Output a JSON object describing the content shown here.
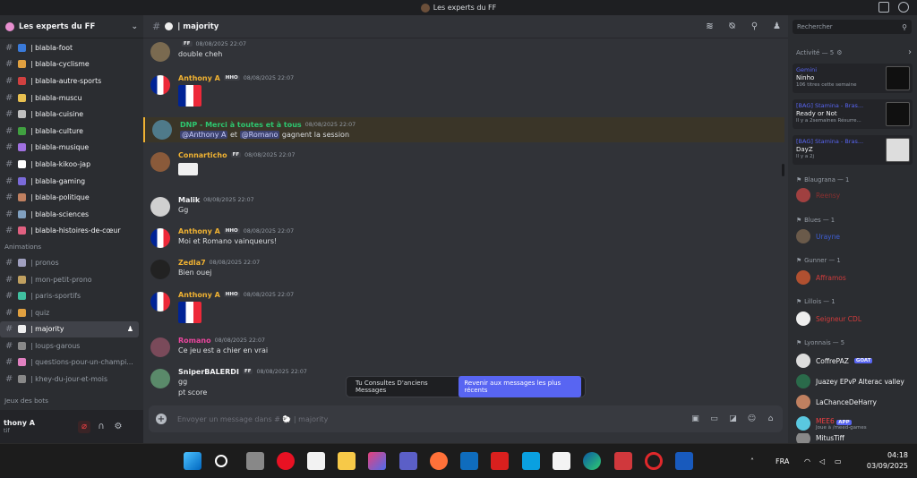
{
  "window": {
    "title": "Les experts du FF"
  },
  "server": {
    "name": "Les experts du FF"
  },
  "channels": [
    {
      "icon": "globe",
      "name": "| blabla-foot"
    },
    {
      "icon": "cyclist",
      "name": "| blabla-cyclisme"
    },
    {
      "icon": "hockey",
      "name": "| blabla-autre-sports"
    },
    {
      "icon": "muscle",
      "name": "| blabla-muscu"
    },
    {
      "icon": "cooking",
      "name": "| blabla-cuisine"
    },
    {
      "icon": "books",
      "name": "| blabla-culture"
    },
    {
      "icon": "music",
      "name": "| blabla-musique"
    },
    {
      "icon": "japan-flag",
      "name": "| blabla-kikoo-jap"
    },
    {
      "icon": "gamepad",
      "name": "| blabla-gaming"
    },
    {
      "icon": "politics",
      "name": "| blabla-politique"
    },
    {
      "icon": "microscope",
      "name": "| blabla-sciences"
    },
    {
      "icon": "hearts",
      "name": "| blabla-histoires-de-cœur"
    }
  ],
  "category_animations": "Animations",
  "anim_channels": [
    {
      "icon": "dice",
      "name": "| pronos"
    },
    {
      "icon": "horse",
      "name": "| mon-petit-prono"
    },
    {
      "icon": "bills",
      "name": "| paris-sportifs"
    },
    {
      "icon": "cookie",
      "name": "| quiz"
    },
    {
      "icon": "sheep",
      "name": "| majority"
    },
    {
      "icon": "wolf",
      "name": "| loups-garous"
    },
    {
      "icon": "brain",
      "name": "| questions-pour-un-champi..."
    },
    {
      "icon": "chains",
      "name": "| khey-du-jour-et-mois"
    }
  ],
  "category_bots": "Jeux des bots",
  "user": {
    "name": "thony A",
    "status": "tif"
  },
  "header": {
    "channel": "| majority"
  },
  "messages": [
    {
      "name": "",
      "badge": "FF",
      "time": "08/08/2025 22:07",
      "text": "double cheh",
      "color": "#5865f2"
    },
    {
      "name": "Anthony A",
      "badge": "HHO",
      "time": "08/08/2025 22:07",
      "text": "",
      "color": "#f0b232"
    },
    {
      "name": "DNP - Merci à toutes et à tous",
      "badge": "",
      "time": "08/08/2025 22:07",
      "m1": "@Anthony A",
      "mid": " et ",
      "m2": "@Romano",
      "tail": " gagnent la session",
      "color": "#2dc770"
    },
    {
      "name": "Connarticho",
      "badge": "FF",
      "time": "08/08/2025 22:07",
      "text": "",
      "color": "#f0b232"
    },
    {
      "name": "Malik",
      "badge": "",
      "time": "08/08/2025 22:07",
      "text": "Gg",
      "color": "#f2f3f5"
    },
    {
      "name": "Anthony A",
      "badge": "HHO",
      "time": "08/08/2025 22:07",
      "text": "Moi et Romano vainqueurs!",
      "color": "#f0b232"
    },
    {
      "name": "Zedla7",
      "badge": "",
      "time": "08/08/2025 22:07",
      "text": "Bien ouej",
      "color": "#f0b232"
    },
    {
      "name": "Anthony A",
      "badge": "HHO",
      "time": "08/08/2025 22:07",
      "text": "",
      "color": "#f0b232"
    },
    {
      "name": "Romano",
      "badge": "",
      "time": "08/08/2025 22:07",
      "text": "Ce jeu est a chier en vrai",
      "color": "#eb459e"
    },
    {
      "name": "SniperBALERDI",
      "badge": "FF",
      "time": "08/08/2025 22:07",
      "text": "gg",
      "text2": "pt score",
      "color": "#f2f3f5"
    }
  ],
  "toast": {
    "text": "Tu Consultes D'anciens Messages",
    "button": "Revenir aux messages les plus récents"
  },
  "composer": {
    "placeholder": "Envoyer un message dans # 🐑 | majority"
  },
  "search": {
    "placeholder": "Rechercher"
  },
  "activity": {
    "label": "Activité — 5"
  },
  "cards": [
    {
      "user": "Gemini",
      "title": "Ninho",
      "sub": "106 titres cette semaine"
    },
    {
      "user": "[BAG] Stamina - Bras...",
      "title": "Ready or Not",
      "sub": "Il y a 2semaines  Résurre..."
    },
    {
      "user": "[BAG] Stamina - Bras...",
      "title": "DayZ",
      "sub": "Il y a 2j"
    }
  ],
  "groups": [
    {
      "label": "Blaugrana — 1",
      "members": [
        {
          "name": "Reensy",
          "color": "#8c3030"
        }
      ]
    },
    {
      "label": "Blues — 1",
      "members": [
        {
          "name": "Urayne",
          "color": "#3f5fd6"
        }
      ]
    },
    {
      "label": "Gunner — 1",
      "members": [
        {
          "name": "Afframos",
          "color": "#d13c3c"
        }
      ]
    },
    {
      "label": "Lillois — 1",
      "members": [
        {
          "name": "Seigneur CDL",
          "color": "#d13c3c"
        }
      ]
    },
    {
      "label": "Lyonnais — 5",
      "members": [
        {
          "name": "CoffrePAZ",
          "color": "#f2f3f5",
          "badge": "GOAT"
        },
        {
          "name": "Juazey EPvP Alterac valley",
          "color": "#f2f3f5"
        },
        {
          "name": "LaChanceDeHarry",
          "color": "#f2f3f5"
        },
        {
          "name": "MEE6",
          "color": "#f23f42",
          "badge": "APP",
          "sub": "Joue à  /meed-games"
        },
        {
          "name": "MitusTiff",
          "color": "#f2f3f5"
        }
      ]
    }
  ],
  "taskbar": {
    "lang": "FRA",
    "time": "04:18",
    "date": "03/09/2025"
  }
}
